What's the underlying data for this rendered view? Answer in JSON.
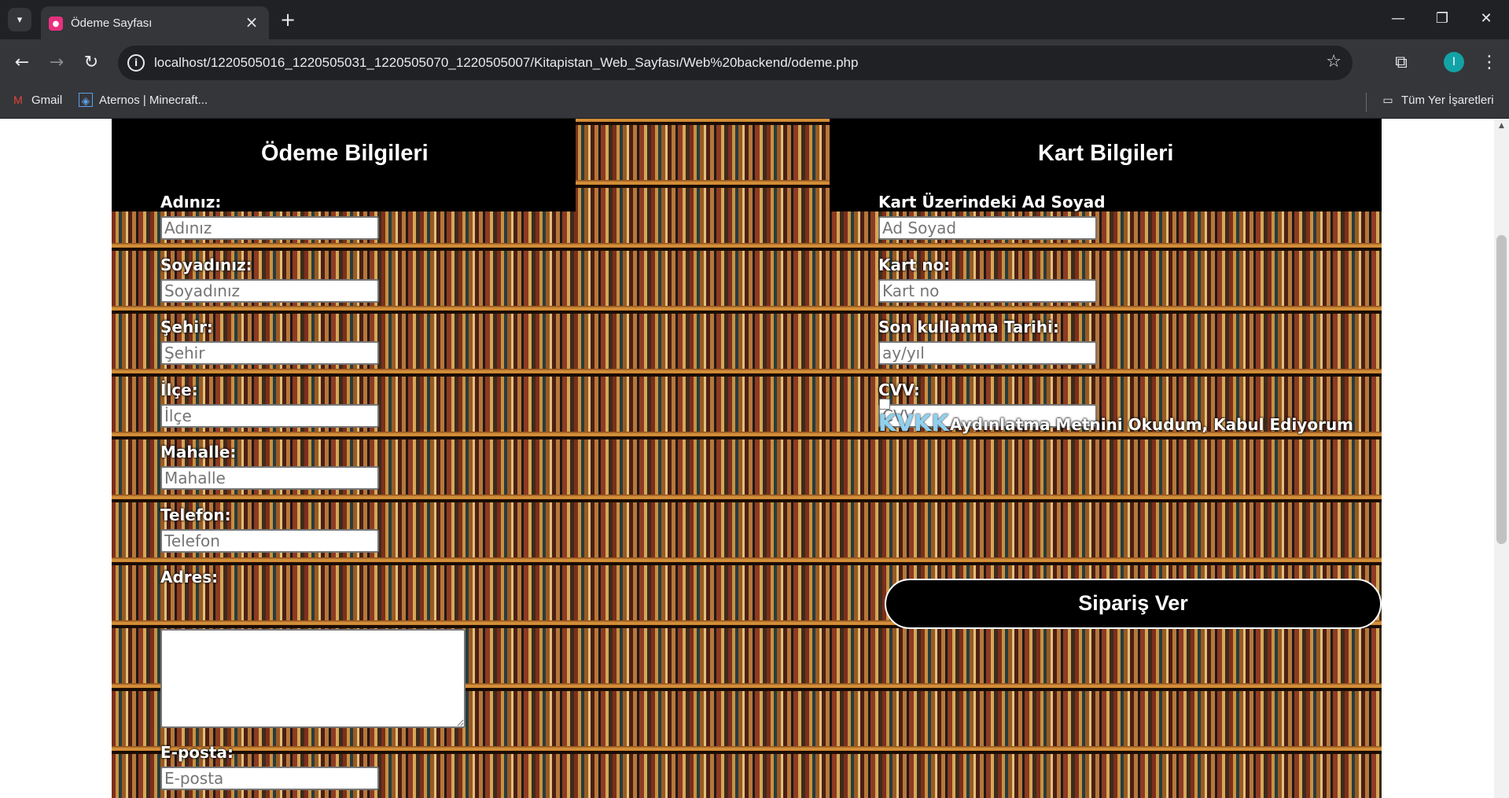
{
  "browser": {
    "tab_title": "Ödeme Sayfası",
    "url": "localhost/1220505016_1220505031_1220505070_1220505007/Kitapistan_Web_Sayfası/Web%20backend/odeme.php",
    "profile_initial": "I",
    "bookmarks": [
      {
        "label": "Gmail",
        "icon": "gmail-icon"
      },
      {
        "label": "Aternos | Minecraft...",
        "icon": "aternos-icon"
      }
    ],
    "all_bookmarks_label": "Tüm Yer İşaretleri"
  },
  "page": {
    "payment_title": "Ödeme Bilgileri",
    "card_title": "Kart Bilgileri",
    "payment_fields": [
      {
        "label": "Adınız:",
        "placeholder": "Adınız"
      },
      {
        "label": "Soyadınız:",
        "placeholder": "Soyadınız"
      },
      {
        "label": "Şehir:",
        "placeholder": "Şehir"
      },
      {
        "label": "İlçe:",
        "placeholder": "İlçe"
      },
      {
        "label": "Mahalle:",
        "placeholder": "Mahalle"
      },
      {
        "label": "Telefon:",
        "placeholder": "Telefon"
      },
      {
        "label": "Adres:",
        "placeholder": ""
      },
      {
        "label": "E-posta:",
        "placeholder": "E-posta"
      }
    ],
    "card_fields": [
      {
        "label": "Kart Üzerindeki Ad Soyad",
        "placeholder": "Ad Soyad"
      },
      {
        "label": "Kart no:",
        "placeholder": "Kart no"
      },
      {
        "label": "Son kullanma Tarihi:",
        "placeholder": "ay/yıl"
      },
      {
        "label": "CVV:",
        "placeholder": "CVV"
      }
    ],
    "kvkk_link": "KVKK",
    "kvkk_text": "Aydınlatma Metnini Okudum, Kabul Ediyorum",
    "order_button": "Sipariş Ver"
  },
  "colors": {
    "header_bg": "#000000",
    "kvkk_link": "#8fd0ee",
    "chrome_dark": "#202124",
    "chrome_toolbar": "#35363a"
  }
}
